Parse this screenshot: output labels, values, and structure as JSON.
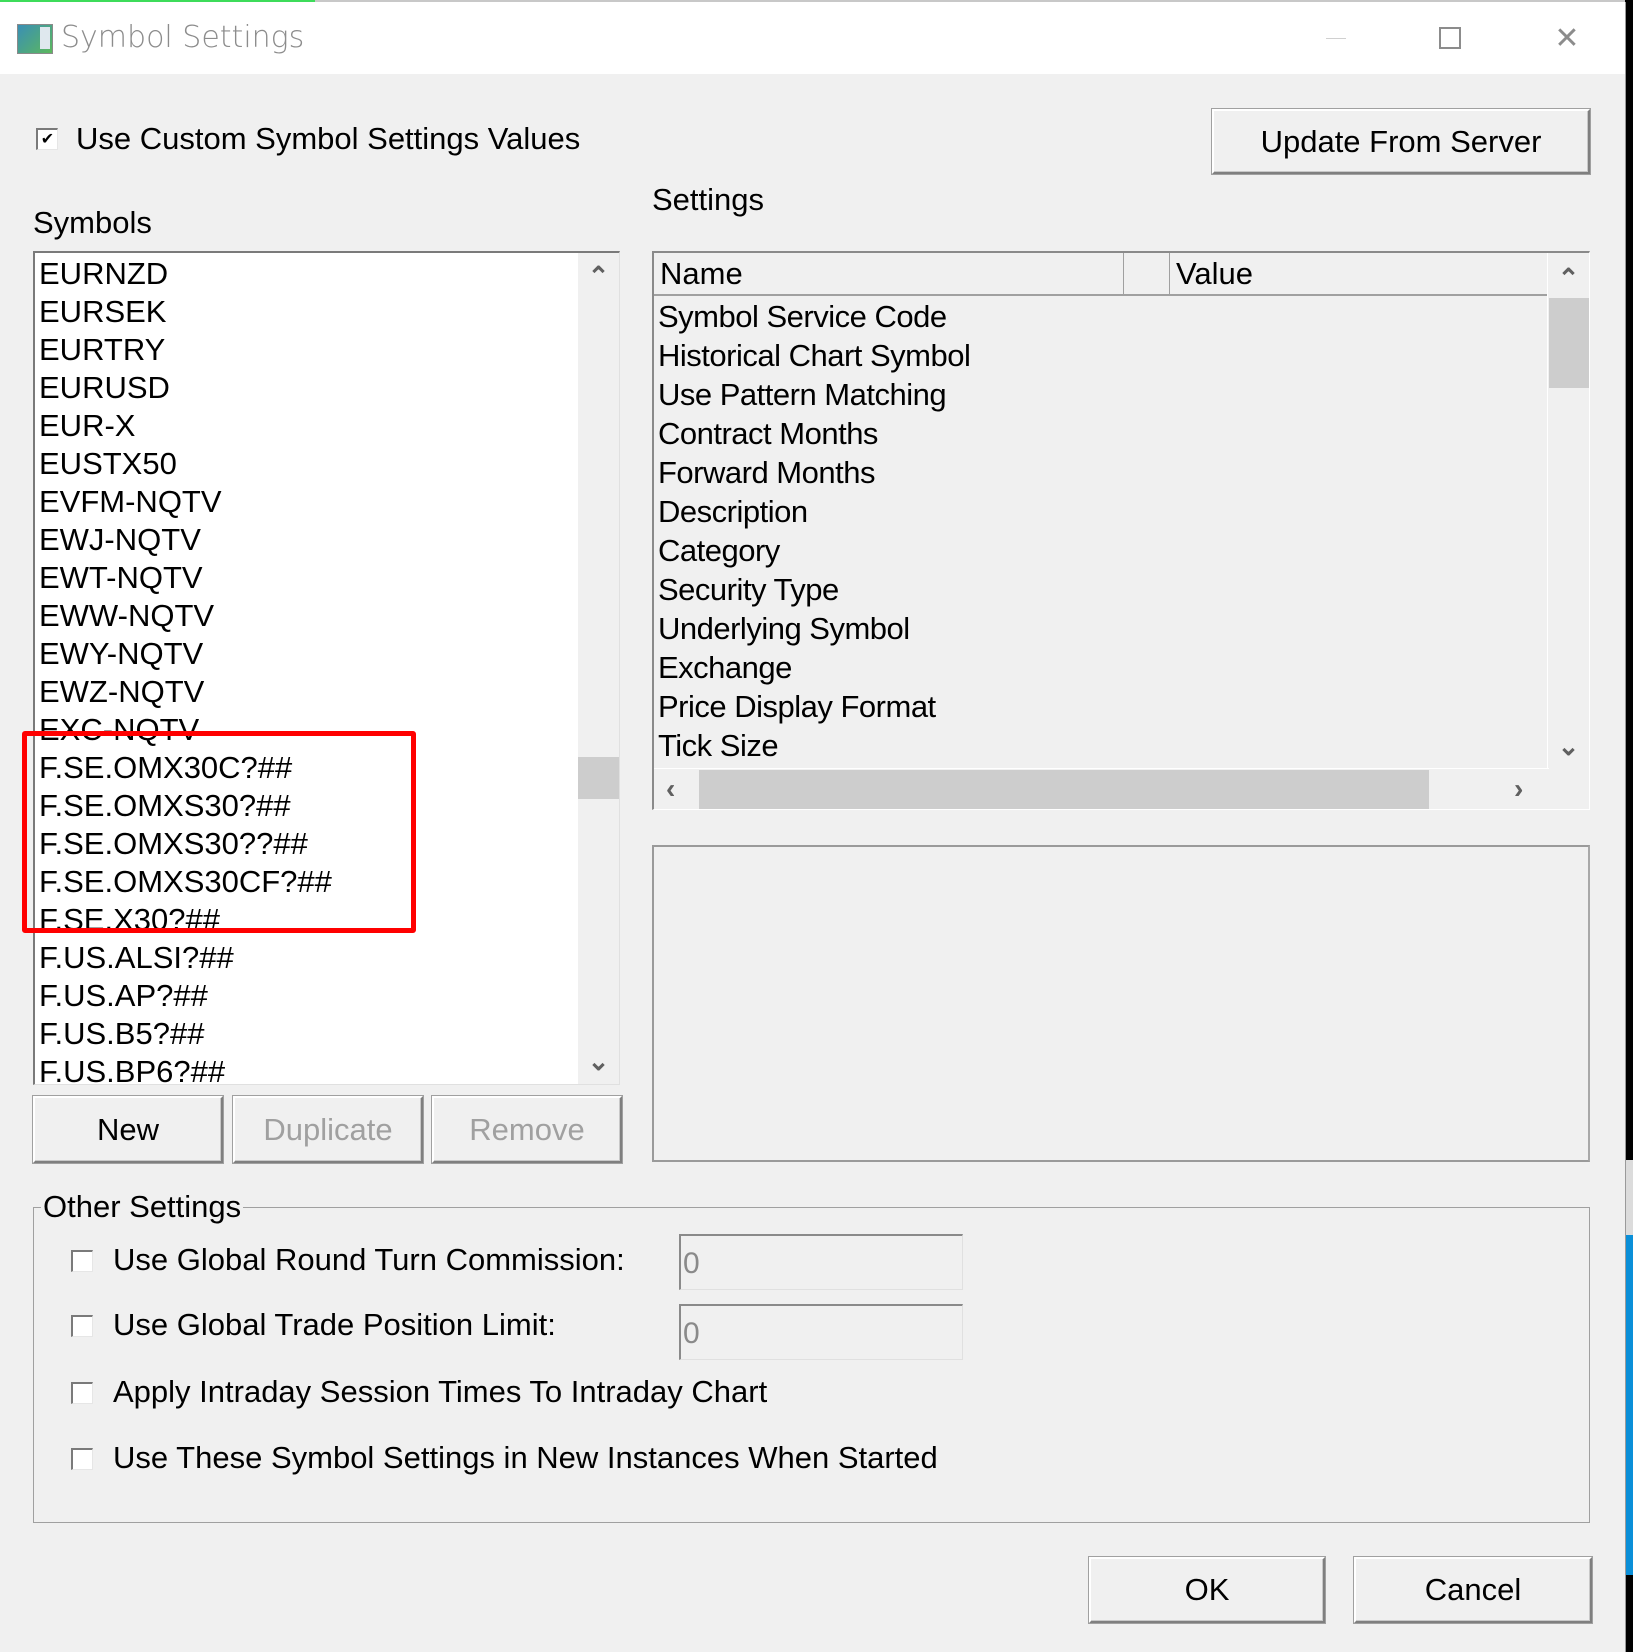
{
  "window": {
    "title": "Symbol Settings",
    "icon": "app-window-icon",
    "controls": {
      "minimize": "minimize-icon",
      "maximize": "maximize-icon",
      "close": "✕"
    }
  },
  "custom_values": {
    "label": "Use Custom Symbol Settings Values",
    "checked": true,
    "check_glyph": "✔"
  },
  "update_button": "Update From Server",
  "symbols": {
    "label": "Symbols",
    "items": [
      "EURNZD",
      "EURSEK",
      "EURTRY",
      "EURUSD",
      "EUR-X",
      "EUSTX50",
      "EVFM-NQTV",
      "EWJ-NQTV",
      "EWT-NQTV",
      "EWW-NQTV",
      "EWY-NQTV",
      "EWZ-NQTV",
      "EXC-NQTV",
      "F.SE.OMX30C?##",
      "F.SE.OMXS30?##",
      "F.SE.OMXS30??##",
      "F.SE.OMXS30CF?##",
      "F.SE.X30?##",
      "F.US.ALSI?##",
      "F.US.AP?##",
      "F.US.B5?##",
      "F.US.BP6?##"
    ],
    "highlighted": [
      "F.SE.OMX30C?##",
      "F.SE.OMXS30?##",
      "F.SE.OMXS30??##",
      "F.SE.OMXS30CF?##",
      "F.SE.X30?##"
    ],
    "highlight_color": "#ff0000",
    "scroll_up": "⌃",
    "scroll_down": "⌄",
    "buttons": {
      "new": "New",
      "duplicate": "Duplicate",
      "remove": "Remove"
    }
  },
  "settings": {
    "label": "Settings",
    "columns": {
      "name": "Name",
      "blank": "",
      "value": "Value"
    },
    "rows": [
      "Symbol Service Code",
      "Historical Chart Symbol",
      "Use Pattern Matching",
      "Contract Months",
      "Forward Months",
      "Description",
      "Category",
      "Security Type",
      "Underlying Symbol",
      "Exchange",
      "Price Display Format",
      "Tick Size"
    ],
    "scroll_up": "⌃",
    "scroll_down": "⌄",
    "scroll_left": "‹",
    "scroll_right": "›"
  },
  "other_settings": {
    "legend": "Other Settings",
    "use_global_commission": {
      "label": "Use Global Round Turn Commission:",
      "checked": false,
      "value": "0"
    },
    "use_global_position_limit": {
      "label": "Use Global Trade Position Limit:",
      "checked": false,
      "value": "0"
    },
    "apply_intraday_session": {
      "label": "Apply Intraday Session Times To Intraday Chart",
      "checked": false
    },
    "use_in_new_instances": {
      "label": "Use These Symbol Settings in New Instances When Started",
      "checked": false
    }
  },
  "footer": {
    "ok": "OK",
    "cancel": "Cancel"
  }
}
